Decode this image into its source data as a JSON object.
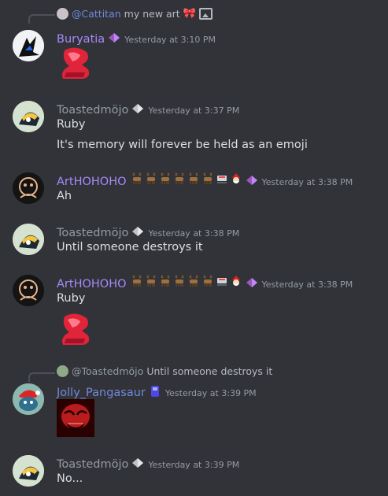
{
  "messages": [
    {
      "reply": {
        "author": "@Cattitan",
        "text": "my new art"
      },
      "author": "Buryatia",
      "time": "Yesterday at 3:10 PM",
      "lines": []
    },
    {
      "author": "Toastedmöjo",
      "time": "Yesterday at 3:37 PM",
      "lines": [
        "Ruby",
        "It's memory will forever be held as an emoji"
      ]
    },
    {
      "author": "ArtHOHOHO",
      "time": "Yesterday at 3:38 PM",
      "lines": [
        "Ah"
      ]
    },
    {
      "author": "Toastedmöjo",
      "time": "Yesterday at 3:38 PM",
      "lines": [
        "Until someone destroys it"
      ]
    },
    {
      "author": "ArtHOHOHO",
      "time": "Yesterday at 3:38 PM",
      "lines": [
        "Ruby"
      ]
    },
    {
      "reply": {
        "author": "@Toastedmöjo",
        "text": "Until someone destroys it"
      },
      "author": "Jolly_Pangasaur",
      "time": "Yesterday at 3:39 PM",
      "lines": []
    },
    {
      "author": "Toastedmöjo",
      "time": "Yesterday at 3:39 PM",
      "lines": [
        "No..."
      ]
    }
  ],
  "colors": {
    "background": "#313338",
    "purple_name": "#a78bfa",
    "grey_name": "#949ba4",
    "blue_name": "#7289da",
    "ruby": "#e0243a"
  },
  "icons": [
    "gift-icon",
    "image-icon",
    "nitro-gem-icon",
    "deer-icon",
    "sleigh-icon",
    "santa-icon",
    "ruby-emoji",
    "sticker-image"
  ]
}
